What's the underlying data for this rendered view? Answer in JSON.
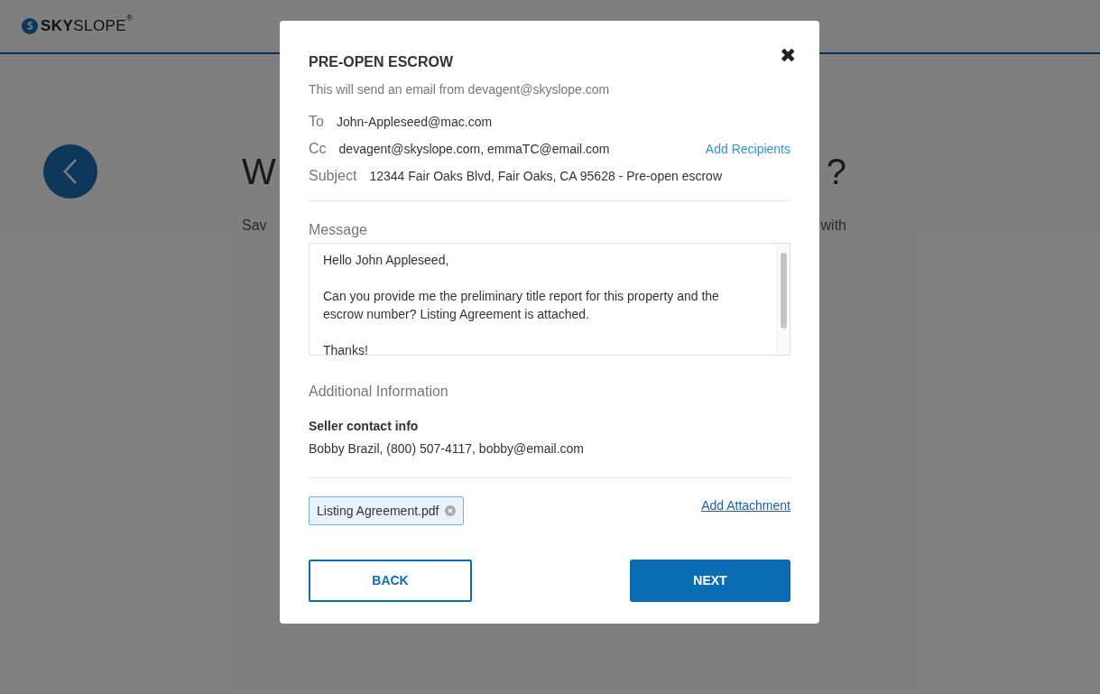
{
  "header": {
    "logo": "**SKY**SLOPE",
    "logo_mark": "®"
  },
  "background": {
    "heading_start": "W",
    "heading_end": "?",
    "text_start": "Sav",
    "text_end": "with"
  },
  "dialog": {
    "title": "PRE-OPEN ESCROW",
    "close": "✖",
    "subtitle": "This will send an email from devagent@skyslope.com",
    "fields": [
      {
        "label": "To",
        "value": "John-Appleseed@mac.com"
      },
      {
        "label": "Cc",
        "value": "devagent@skyslope.com, emmaTC@email.com",
        "link": "Add Recipients"
      },
      {
        "label": "Subject",
        "value": "12344 Fair Oaks Blvd, Fair Oaks, CA 95628 - Pre-open escrow"
      }
    ],
    "message_label": "Message",
    "message": "Hello John Appleseed,\n\nCan you provide me the preliminary title report for this property and the escrow number? Listing Agreement is attached.\n\nThanks!",
    "additional_label": "Additional Information",
    "seller_title": "Seller contact info",
    "seller_info": "Bobby Brazil, (800) 507-4117, bobby@email.com",
    "attachments": [
      "Listing Agreement.pdf"
    ],
    "add_attachment": "Add Attachment",
    "buttons": [
      {
        "label": "BACK",
        "kind": "secondary"
      },
      {
        "label": "NEXT",
        "kind": "primary"
      }
    ]
  }
}
